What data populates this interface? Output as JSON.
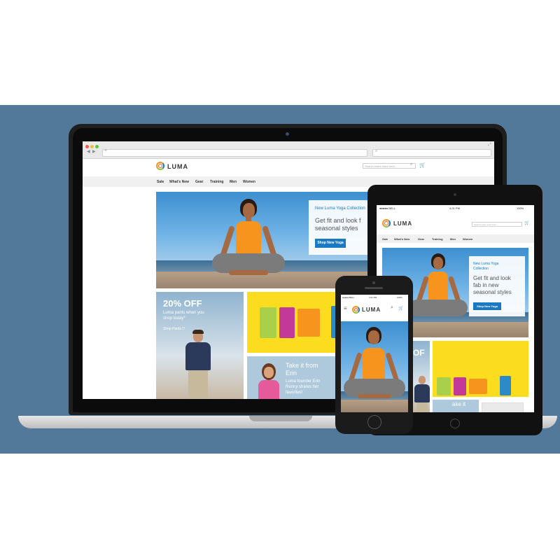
{
  "brand": {
    "logo_text": "LUMA",
    "colors": {
      "background_band": "#53799a",
      "link_blue": "#1979c3",
      "tank_green": "#a8d04a",
      "tank_magenta": "#c2399a",
      "tank_orange": "#f7941d",
      "tank_blue": "#2e89c9",
      "promo_yellow": "#fbdc1e"
    }
  },
  "laptop": {
    "browser": {
      "nav_icons": [
        "back-icon",
        "forward-icon",
        "add-tab-icon"
      ],
      "search_icon": "magnifier-icon"
    },
    "site": {
      "search_placeholder": "Search entire store here...",
      "menu": [
        "Sale",
        "What's New",
        "Gear",
        "Training",
        "Men",
        "Women"
      ],
      "hero": {
        "eyebrow": "New Luma Yoga Collection",
        "headline_line1": "Get fit and look f",
        "headline_line2": "seasonal styles",
        "button": "Shop New Yoga"
      },
      "offer": {
        "title": "20% OFF",
        "text_line1": "Luma pants when you",
        "text_line2": "shop today*",
        "link": "Shop Pants"
      },
      "erin": {
        "title_line1": "Take it from",
        "title_line2": "Erin",
        "text_line1": "Luma founder Erin",
        "text_line2": "Renny shares her",
        "text_line3": "favorites!"
      }
    }
  },
  "tablet": {
    "status": {
      "carrier": "BELL",
      "time": "4:21 PM",
      "battery": "100%"
    },
    "site": {
      "search_placeholder": "Search entire store here...",
      "menu": [
        "Sale",
        "What's New",
        "Gear",
        "Training",
        "Men",
        "Women"
      ],
      "hero": {
        "eyebrow_line1": "New Luma Yoga",
        "eyebrow_line2": "Collection",
        "headline_line1": "Get fit and look",
        "headline_line2": "fab in new",
        "headline_line3": "seasonal styles",
        "button": "Shop New Yoga"
      },
      "offer_partial": "OF",
      "erin_partial": "ake it"
    }
  },
  "phone": {
    "status": {
      "carrier": "BELL",
      "time": "4:21 PM",
      "battery": "100%"
    }
  }
}
